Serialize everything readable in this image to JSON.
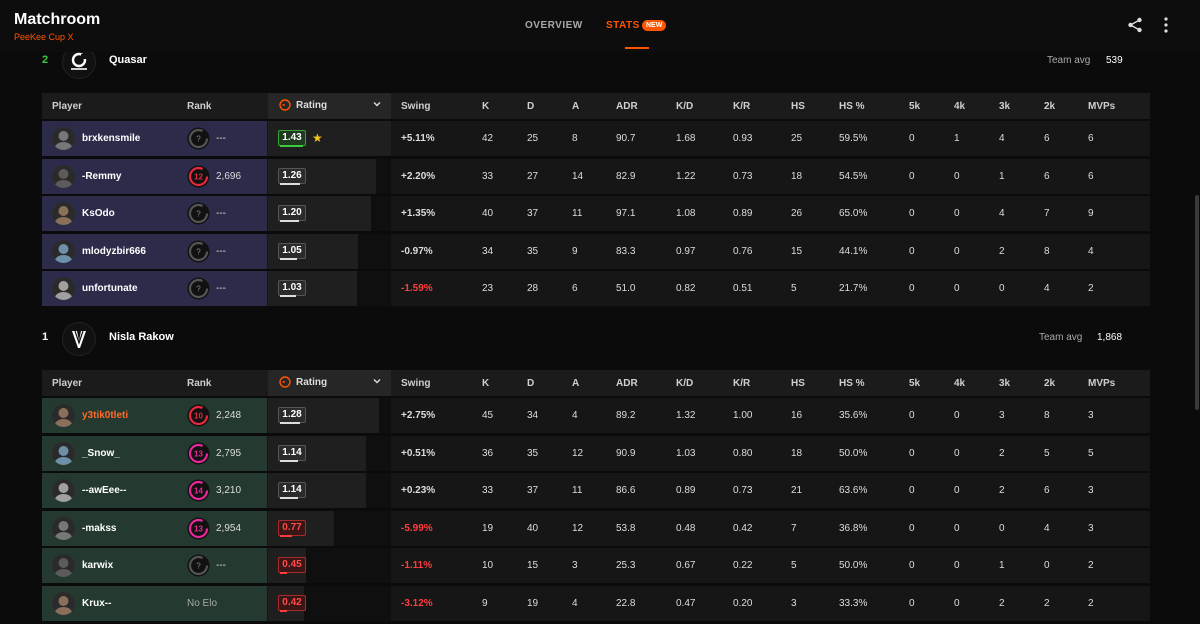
{
  "header": {
    "app_title": "Matchroom",
    "subtitle": "PeeKee Cup X",
    "tabs": [
      {
        "label": "OVERVIEW"
      },
      {
        "label": "STATS"
      }
    ],
    "new_badge": "NEW",
    "icons": [
      "share-icon",
      "more-vertical-icon"
    ]
  },
  "colors": {
    "accent": "#ff5500",
    "team1_player_bg": "#2c2b49",
    "team2_player_bg": "#24392f",
    "negative": "#ff3d3d",
    "positive_rating": "#3fc93f",
    "star": "#f5c418"
  },
  "columns": {
    "player": "Player",
    "rank": "Rank",
    "rating": "Rating",
    "swing": "Swing",
    "k": "K",
    "d": "D",
    "a": "A",
    "adr": "ADR",
    "kd": "K/D",
    "kr": "K/R",
    "hs": "HS",
    "hsp": "HS %",
    "k5": "5k",
    "k4": "4k",
    "k3": "3k",
    "k2": "2k",
    "mvps": "MVPs"
  },
  "teams": [
    {
      "rank": "2",
      "name": "Quasar",
      "avg_label": "Team avg",
      "avg_value": "539",
      "players": [
        {
          "name": "brxkensmile",
          "level": "",
          "elo": "---",
          "rating": "1.43",
          "rating_level": 1.0,
          "top": true,
          "swing": "+5.11%",
          "k": "42",
          "d": "25",
          "a": "8",
          "adr": "90.7",
          "kd": "1.68",
          "kr": "0.93",
          "hs": "25",
          "hsp": "59.5%",
          "k5": "0",
          "k4": "1",
          "k3": "4",
          "k2": "6",
          "mvps": "6"
        },
        {
          "name": "-Remmy",
          "level": "12",
          "elo": "2,696",
          "rating": "1.26",
          "rating_level": 0.88,
          "swing": "+2.20%",
          "k": "33",
          "d": "27",
          "a": "14",
          "adr": "82.9",
          "kd": "1.22",
          "kr": "0.73",
          "hs": "18",
          "hsp": "54.5%",
          "k5": "0",
          "k4": "0",
          "k3": "1",
          "k2": "6",
          "mvps": "6"
        },
        {
          "name": "KsOdo",
          "level": "",
          "elo": "---",
          "rating": "1.20",
          "rating_level": 0.84,
          "swing": "+1.35%",
          "k": "40",
          "d": "37",
          "a": "11",
          "adr": "97.1",
          "kd": "1.08",
          "kr": "0.89",
          "hs": "26",
          "hsp": "65.0%",
          "k5": "0",
          "k4": "0",
          "k3": "4",
          "k2": "7",
          "mvps": "9"
        },
        {
          "name": "mlodyzbir666",
          "level": "",
          "elo": "---",
          "rating": "1.05",
          "rating_level": 0.73,
          "swing": "-0.97%",
          "k": "34",
          "d": "35",
          "a": "9",
          "adr": "83.3",
          "kd": "0.97",
          "kr": "0.76",
          "hs": "15",
          "hsp": "44.1%",
          "k5": "0",
          "k4": "0",
          "k3": "2",
          "k2": "8",
          "mvps": "4"
        },
        {
          "name": "unfortunate",
          "level": "",
          "elo": "---",
          "rating": "1.03",
          "rating_level": 0.72,
          "swing": "-1.59%",
          "negative": true,
          "k": "23",
          "d": "28",
          "a": "6",
          "adr": "51.0",
          "kd": "0.82",
          "kr": "0.51",
          "hs": "5",
          "hsp": "21.7%",
          "k5": "0",
          "k4": "0",
          "k3": "0",
          "k2": "4",
          "mvps": "2"
        }
      ]
    },
    {
      "rank": "1",
      "name": "Nisla Rakow",
      "avg_label": "Team avg",
      "avg_value": "1,868",
      "players": [
        {
          "name": "y3tik0tleti",
          "highlight": true,
          "level": "10",
          "elo": "2,248",
          "rating": "1.28",
          "rating_level": 0.9,
          "swing": "+2.75%",
          "k": "45",
          "d": "34",
          "a": "4",
          "adr": "89.2",
          "kd": "1.32",
          "kr": "1.00",
          "hs": "16",
          "hsp": "35.6%",
          "k5": "0",
          "k4": "0",
          "k3": "3",
          "k2": "8",
          "mvps": "3"
        },
        {
          "name": "_Snow_",
          "level": "13",
          "elo": "2,795",
          "rating": "1.14",
          "rating_level": 0.8,
          "swing": "+0.51%",
          "k": "36",
          "d": "35",
          "a": "12",
          "adr": "90.9",
          "kd": "1.03",
          "kr": "0.80",
          "hs": "18",
          "hsp": "50.0%",
          "k5": "0",
          "k4": "0",
          "k3": "2",
          "k2": "5",
          "mvps": "5"
        },
        {
          "name": "--awEee--",
          "level": "14",
          "elo": "3,210",
          "rating": "1.14",
          "rating_level": 0.8,
          "swing": "+0.23%",
          "k": "33",
          "d": "37",
          "a": "11",
          "adr": "86.6",
          "kd": "0.89",
          "kr": "0.73",
          "hs": "21",
          "hsp": "63.6%",
          "k5": "0",
          "k4": "0",
          "k3": "2",
          "k2": "6",
          "mvps": "3"
        },
        {
          "name": "-makss",
          "level": "13",
          "elo": "2,954",
          "rating": "0.77",
          "rating_level": 0.54,
          "bad": true,
          "swing": "-5.99%",
          "negative": true,
          "k": "19",
          "d": "40",
          "a": "12",
          "adr": "53.8",
          "kd": "0.48",
          "kr": "0.42",
          "hs": "7",
          "hsp": "36.8%",
          "k5": "0",
          "k4": "0",
          "k3": "0",
          "k2": "4",
          "mvps": "3"
        },
        {
          "name": "karwix",
          "level": "",
          "elo": "---",
          "rating": "0.45",
          "rating_level": 0.31,
          "bad": true,
          "swing": "-1.11%",
          "negative": true,
          "k": "10",
          "d": "15",
          "a": "3",
          "adr": "25.3",
          "kd": "0.67",
          "kr": "0.22",
          "hs": "5",
          "hsp": "50.0%",
          "k5": "0",
          "k4": "0",
          "k3": "1",
          "k2": "0",
          "mvps": "2"
        },
        {
          "name": "Krux--",
          "level": "none",
          "elo": "No Elo",
          "rating": "0.42",
          "rating_level": 0.29,
          "bad": true,
          "swing": "-3.12%",
          "negative": true,
          "k": "9",
          "d": "19",
          "a": "4",
          "adr": "22.8",
          "kd": "0.47",
          "kr": "0.20",
          "hs": "3",
          "hsp": "33.3%",
          "k5": "0",
          "k4": "0",
          "k3": "2",
          "k2": "2",
          "mvps": "2"
        }
      ]
    }
  ]
}
